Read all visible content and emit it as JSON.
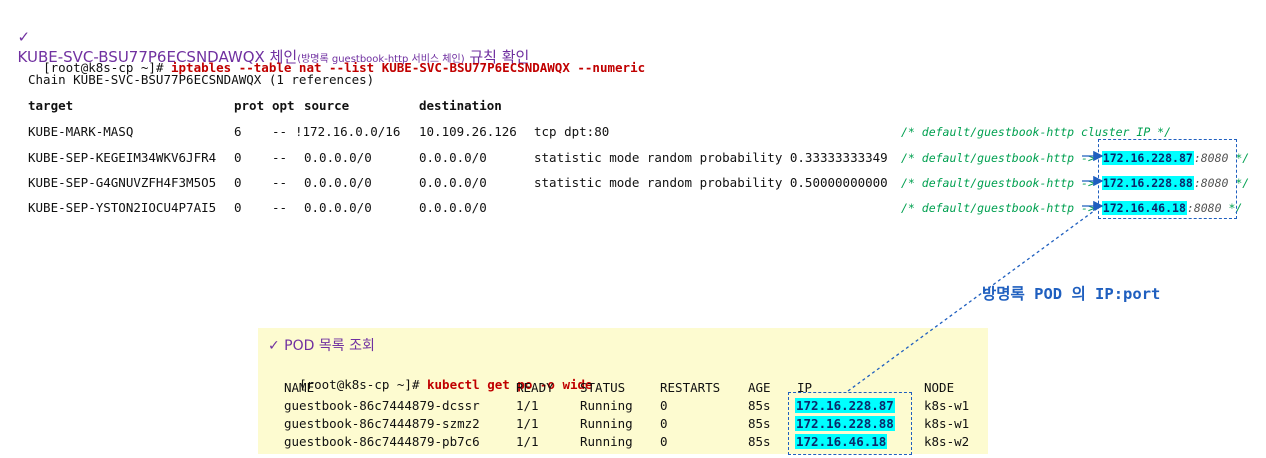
{
  "heading": {
    "check": "✓",
    "main": "KUBE-SVC-BSU77P6ECSNDAWQX 체인",
    "sub": "(방명록 guestbook-http 서비스 체인)",
    "tail": " 규칙 확인"
  },
  "iptables": {
    "prompt": "[root@k8s-cp ~]# ",
    "command": "iptables --table nat --list KUBE-SVC-BSU77P6ECSNDAWQX --numeric",
    "chain_line": "Chain KUBE-SVC-BSU77P6ECSNDAWQX (1 references)",
    "headers": [
      "target",
      "prot",
      "opt",
      "source",
      "destination"
    ],
    "rows": [
      {
        "target": "KUBE-MARK-MASQ",
        "prot": "6",
        "opt": "--",
        "source": "!172.16.0.0/16",
        "destination": "10.109.26.126",
        "extra": "tcp dpt:80",
        "comment_pre": "/* default/guestbook-http cluster IP */",
        "ip": "",
        "port": "",
        "comment_post": ""
      },
      {
        "target": "KUBE-SEP-KEGEIM34WKV6JFR4",
        "prot": "0",
        "opt": "--",
        "source": "0.0.0.0/0",
        "destination": "0.0.0.0/0",
        "extra": "statistic mode random probability 0.33333333349",
        "comment_pre": "/* default/guestbook-http -> ",
        "ip": "172.16.228.87",
        "port": ":8080",
        "comment_post": " */"
      },
      {
        "target": "KUBE-SEP-G4GNUVZFH4F3M5O5",
        "prot": "0",
        "opt": "--",
        "source": "0.0.0.0/0",
        "destination": "0.0.0.0/0",
        "extra": "statistic mode random probability 0.50000000000",
        "comment_pre": "/* default/guestbook-http -> ",
        "ip": "172.16.228.88",
        "port": ":8080",
        "comment_post": " */"
      },
      {
        "target": "KUBE-SEP-YSTON2IOCU4P7AI5",
        "prot": "0",
        "opt": "--",
        "source": "0.0.0.0/0",
        "destination": "0.0.0.0/0",
        "extra": "",
        "comment_pre": "/* default/guestbook-http -> ",
        "ip": "172.16.46.18",
        "port": ":8080",
        "comment_post": " */"
      }
    ]
  },
  "annotation": "방명록 POD 의 IP:port",
  "pods": {
    "title": "✓ POD 목록 조회",
    "prompt": "[root@k8s-cp ~]# ",
    "command": "kubectl get po -o wide",
    "headers": [
      "NAME",
      "READY",
      "STATUS",
      "RESTARTS",
      "AGE",
      "IP",
      "NODE"
    ],
    "rows": [
      {
        "name": "guestbook-86c7444879-dcssr",
        "ready": "1/1",
        "status": "Running",
        "restarts": "0",
        "age": "85s",
        "ip": "172.16.228.87",
        "node": "k8s-w1"
      },
      {
        "name": "guestbook-86c7444879-szmz2",
        "ready": "1/1",
        "status": "Running",
        "restarts": "0",
        "age": "85s",
        "ip": "172.16.228.88",
        "node": "k8s-w1"
      },
      {
        "name": "guestbook-86c7444879-pb7c6",
        "ready": "1/1",
        "status": "Running",
        "restarts": "0",
        "age": "85s",
        "ip": "172.16.46.18",
        "node": "k8s-w2"
      }
    ]
  },
  "colors": {
    "heading": "#7030a0",
    "command": "#c00000",
    "comment": "#00a050",
    "highlight": "#00ffff",
    "arrow": "#1f5fbf",
    "pod_bg": "#fdfbd0"
  }
}
